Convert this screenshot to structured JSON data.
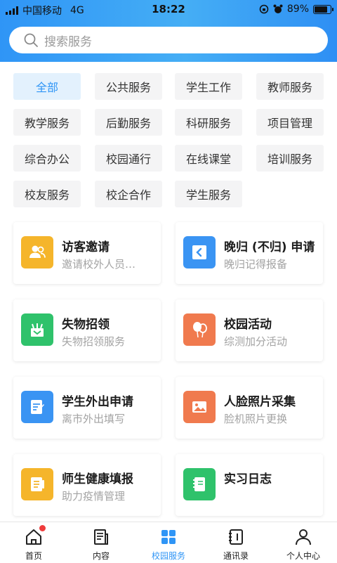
{
  "status_bar": {
    "carrier": "中国移动",
    "network": "4G",
    "time": "18:22",
    "battery": "89%"
  },
  "search": {
    "placeholder": "搜索服务"
  },
  "categories": [
    "全部",
    "公共服务",
    "学生工作",
    "教师服务",
    "教学服务",
    "后勤服务",
    "科研服务",
    "项目管理",
    "综合办公",
    "校园通行",
    "在线课堂",
    "培训服务",
    "校友服务",
    "校企合作",
    "学生服务"
  ],
  "active_category": "全部",
  "services": [
    {
      "title": "访客邀请",
      "subtitle": "邀请校外人员…",
      "color": "#f5b52b",
      "icon": "visitors-icon"
    },
    {
      "title": "晚归 (不归) 申请",
      "subtitle": "晚归记得报备",
      "color": "#3a94f3",
      "icon": "return-icon"
    },
    {
      "title": "失物招领",
      "subtitle": "失物招领服务",
      "color": "#2fc26b",
      "icon": "lost-found-icon"
    },
    {
      "title": "校园活动",
      "subtitle": "综测加分活动",
      "color": "#f07a4e",
      "icon": "balloon-icon"
    },
    {
      "title": "学生外出申请",
      "subtitle": "离市外出填写",
      "color": "#3a94f3",
      "icon": "edit-form-icon"
    },
    {
      "title": "人脸照片采集",
      "subtitle": "脸机照片更换",
      "color": "#f07a4e",
      "icon": "photo-icon"
    },
    {
      "title": "师生健康填报",
      "subtitle": "助力疫情管理",
      "color": "#f5b52b",
      "icon": "health-report-icon"
    },
    {
      "title": "实习日志",
      "subtitle": "",
      "color": "#2fc26b",
      "icon": "notebook-icon"
    }
  ],
  "tabs": [
    {
      "label": "首页",
      "icon": "home-icon"
    },
    {
      "label": "内容",
      "icon": "content-icon"
    },
    {
      "label": "校园服务",
      "icon": "grid-icon"
    },
    {
      "label": "通讯录",
      "icon": "contacts-icon"
    },
    {
      "label": "个人中心",
      "icon": "user-icon"
    }
  ],
  "active_tab": "校园服务",
  "colors": {
    "primary": "#2f95f6",
    "badge": "#ef3b3b"
  }
}
